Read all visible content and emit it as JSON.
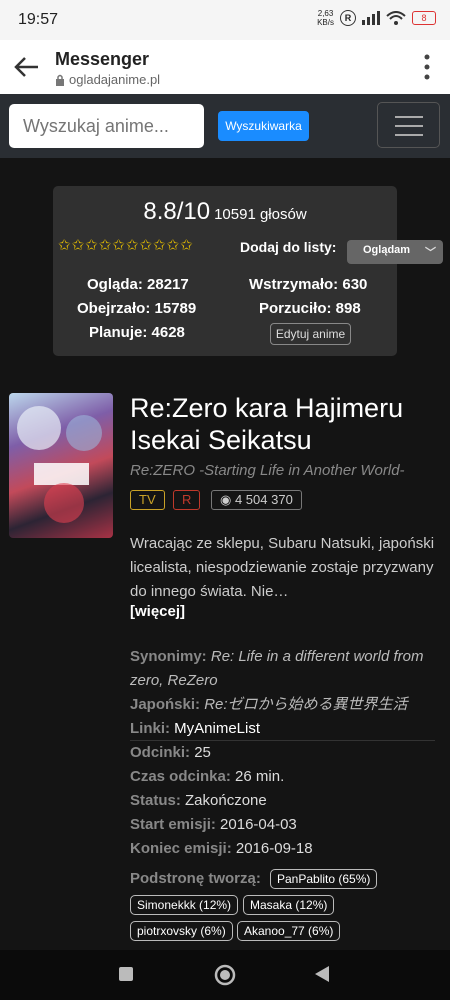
{
  "status_bar": {
    "time": "19:57",
    "speed_top": "2,63",
    "speed_bottom": "KB/s",
    "r_badge": "R",
    "battery": "8"
  },
  "browser": {
    "title": "Messenger",
    "url": "ogladajanime.pl"
  },
  "nav": {
    "search_placeholder": "Wyszukaj anime...",
    "search_button": "Wyszukiwarka"
  },
  "stats": {
    "score": "8.8/10",
    "votes": "10591 głosów",
    "stars": "✩✩✩✩✩✩✩✩✩✩",
    "add_label": "Dodaj do listy:",
    "list_value": "Oglądam",
    "oglada": "Ogląda: 28217",
    "obejrzalo": "Obejrzało: 15789",
    "planuje": "Planuje: 4628",
    "wstrzymalo": "Wstrzymało: 630",
    "porzucilo": "Porzuciło: 898",
    "edit": "Edytuj anime"
  },
  "anime": {
    "title": "Re:Zero kara Hajimeru Isekai Seikatsu",
    "alt_title": "Re:ZERO -Starting Life in Another World-",
    "tags": {
      "type": "TV",
      "rating": "R",
      "views": "4 504 370"
    },
    "description": "Wracając ze sklepu, Subaru Natsuki, japoński licealista, niespodziewanie zostaje przyzwany do innego świata. Nie…",
    "more": "[więcej]",
    "synonyms_k": "Synonimy:",
    "synonyms_v": "Re: Life in a different world from zero, ReZero",
    "japanese_k": "Japoński:",
    "japanese_v": "Re:ゼロから始める異世界生活",
    "links_k": "Linki:",
    "links_v": "MyAnimeList",
    "episodes_k": "Odcinki:",
    "episodes_v": "25",
    "duration_k": "Czas odcinka:",
    "duration_v": "26 min.",
    "status_k": "Status:",
    "status_v": "Zakończone",
    "start_k": "Start emisji:",
    "start_v": "2016-04-03",
    "end_k": "Koniec emisji:",
    "end_v": "2016-09-18",
    "subpage_k": "Podstronę tworzą:",
    "contributors": [
      "PanPablito (65%)",
      "Simonekkk (12%)",
      "Masaka (12%)",
      "piotrxovsky (6%)",
      "Akanoo_77 (6%)"
    ]
  },
  "colors": {
    "accent": "#1a8cff",
    "star": "#e8c000",
    "tag_tv": "#c9a227",
    "tag_r": "#c0392b"
  }
}
